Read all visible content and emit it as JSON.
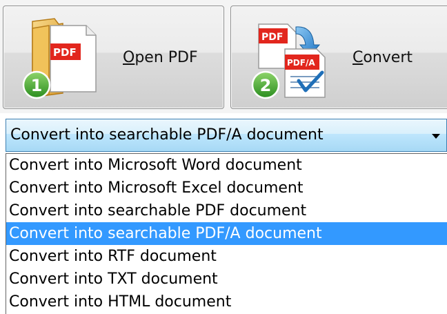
{
  "toolbar": {
    "open_button": {
      "label_mnemonic": "O",
      "label_rest": "pen PDF",
      "icon": "folder-pdf-icon",
      "badge_number": "1",
      "icon_text": "PDF"
    },
    "convert_button": {
      "label_mnemonic": "C",
      "label_rest": "onvert",
      "icon": "pdf-convert-icon",
      "badge_number": "2",
      "icon_text_top": "PDF",
      "icon_text_bottom": "PDF/A"
    }
  },
  "conversion_select": {
    "selected_value": "Convert into searchable PDF/A document",
    "arrow_icon": "dropdown-arrow-icon",
    "options": [
      "Convert into Microsoft Word document",
      "Convert into Microsoft Excel document",
      "Convert into searchable PDF document",
      "Convert into searchable PDF/A document",
      "Convert into RTF document",
      "Convert into TXT document",
      "Convert into HTML document"
    ],
    "selected_index": 3
  },
  "colors": {
    "selection_highlight": "#3399ff",
    "combo_border": "#3c7fb1",
    "badge_green": "#3fa535",
    "pdf_red": "#e2261d",
    "convert_arrow_blue": "#2d8fd8"
  }
}
